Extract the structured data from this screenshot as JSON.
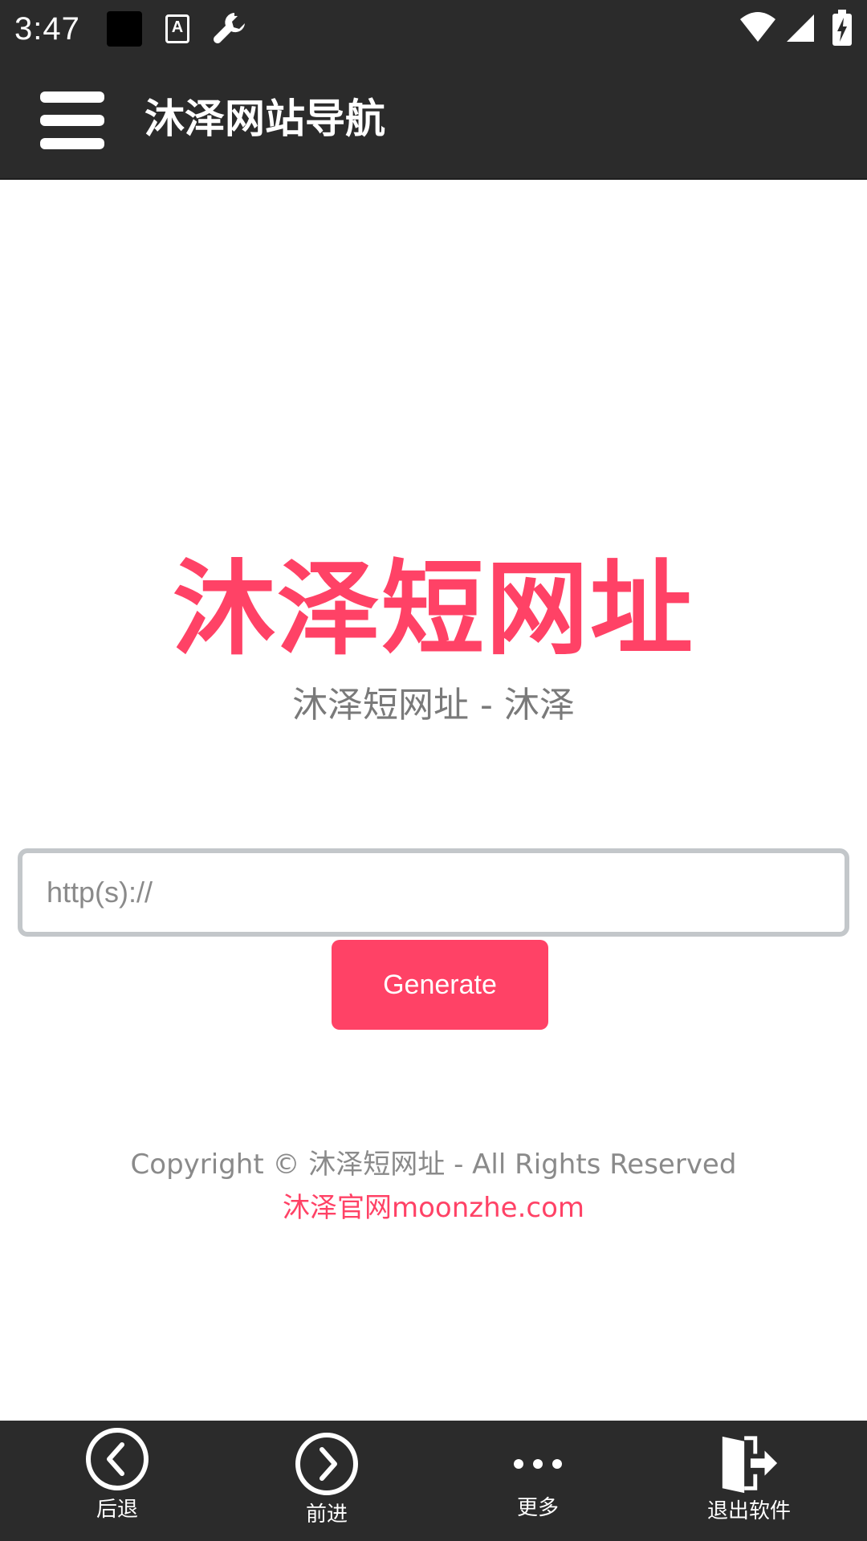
{
  "status_bar": {
    "time": "3:47",
    "icons": [
      "black-square-icon",
      "text-a-icon",
      "wrench-icon",
      "wifi-icon",
      "cell-signal-icon",
      "battery-charging-icon"
    ],
    "a_glyph": "A"
  },
  "app_bar": {
    "title": "沐泽网站导航",
    "menu_icon": "hamburger-menu-icon"
  },
  "main": {
    "brand_title": "沐泽短网址",
    "brand_subtitle": "沐泽短网址 - 沐泽",
    "url_input": {
      "placeholder": "http(s)://",
      "value": ""
    },
    "generate_label": "Generate",
    "copyright": "Copyright © 沐泽短网址 - All Rights Reserved",
    "site_link": "沐泽官网moonzhe.com"
  },
  "bottom_nav": {
    "back_label": "后退",
    "forward_label": "前进",
    "more_label": "更多",
    "exit_label": "退出软件"
  },
  "colors": {
    "accent": "#ff4266",
    "bar_background": "#2b2b2b",
    "muted_text": "#7a7a7a",
    "input_border": "#c3c7ca"
  }
}
